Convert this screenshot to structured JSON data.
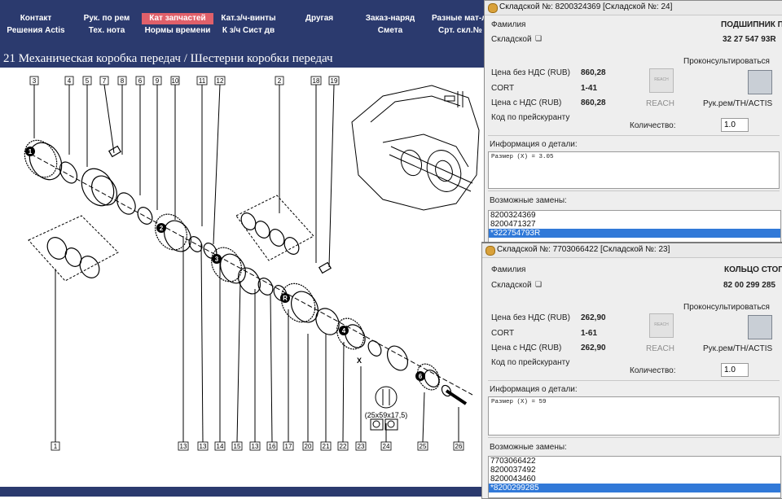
{
  "nav": {
    "row1": [
      "Контакт",
      "Рук. по рем",
      "Кат запчастей",
      "Кат.з/ч-винты",
      "Другая",
      "Заказ-наряд",
      "Разные мат-л"
    ],
    "row2": [
      "Решения Actis",
      "Тех. нота",
      "Нормы времени",
      "К з/ч Сист дв",
      "",
      "Смета",
      "Срт. скл.№"
    ]
  },
  "page_title": "21 Механическая коробка передач / Шестерни коробки передач",
  "diagram": {
    "top_labels": [
      "3",
      "4",
      "5",
      "7",
      "8",
      "6",
      "9",
      "10",
      "11",
      "12",
      "2",
      "18",
      "19"
    ],
    "bottom_labels": [
      "1",
      "13",
      "13",
      "14",
      "15",
      "13",
      "16",
      "17",
      "20",
      "21",
      "22",
      "23",
      "24",
      "25",
      "26"
    ],
    "dimension": "(25x59x17,5)",
    "axis_label": "X",
    "gear_markers": [
      "1",
      "2",
      "3",
      "R",
      "4",
      "6"
    ]
  },
  "windows": [
    {
      "title": "Складской №: 8200324369 [Складской №: 24]",
      "family_label": "Фамилия",
      "family_value": "ПОДШИПНИК П",
      "stock_label": "Складской",
      "stock_value": "32 27 547 93R",
      "consult_label": "Проконсультироваться",
      "price_excl_label": "Цена без НДС (RUB)",
      "price_excl_value": "860,28",
      "cort_label": "CORT",
      "cort_value": "1-41",
      "price_incl_label": "Цена с НДС (RUB)",
      "price_incl_value": "860,28",
      "reach_label": "REACH",
      "manual_label": "Рук.рем/TH/ACTIS",
      "code_label": "Код по прейскуранту",
      "qty_label": "Количество:",
      "qty_value": "1.0",
      "info_label": "Информация о детали:",
      "info_value": "Размер (X) = 3.05",
      "replacements_label": "Возможные замены:",
      "replacements": [
        "8200324369",
        "8200471327",
        "*322754793R"
      ],
      "selected_index": 2
    },
    {
      "title": "Складской №: 7703066422 [Складской №: 23]",
      "family_label": "Фамилия",
      "family_value": "КОЛЬЦО СТОПО",
      "stock_label": "Складской",
      "stock_value": "82 00 299 285",
      "consult_label": "Проконсультироваться",
      "price_excl_label": "Цена без НДС (RUB)",
      "price_excl_value": "262,90",
      "cort_label": "CORT",
      "cort_value": "1-61",
      "price_incl_label": "Цена с НДС (RUB)",
      "price_incl_value": "262,90",
      "reach_label": "REACH",
      "manual_label": "Рук.рем/TH/ACTIS",
      "code_label": "Код по прейскуранту",
      "qty_label": "Количество:",
      "qty_value": "1.0",
      "info_label": "Информация о детали:",
      "info_value": "Размер (X) = 59",
      "replacements_label": "Возможные замены:",
      "replacements": [
        "7703066422",
        "8200037492",
        "8200043460",
        "*8200299285"
      ],
      "selected_index": 3
    }
  ],
  "colors": {
    "nav_bg": "#2b3a6e",
    "active_tab": "#e0606a",
    "selection": "#3179d8"
  }
}
